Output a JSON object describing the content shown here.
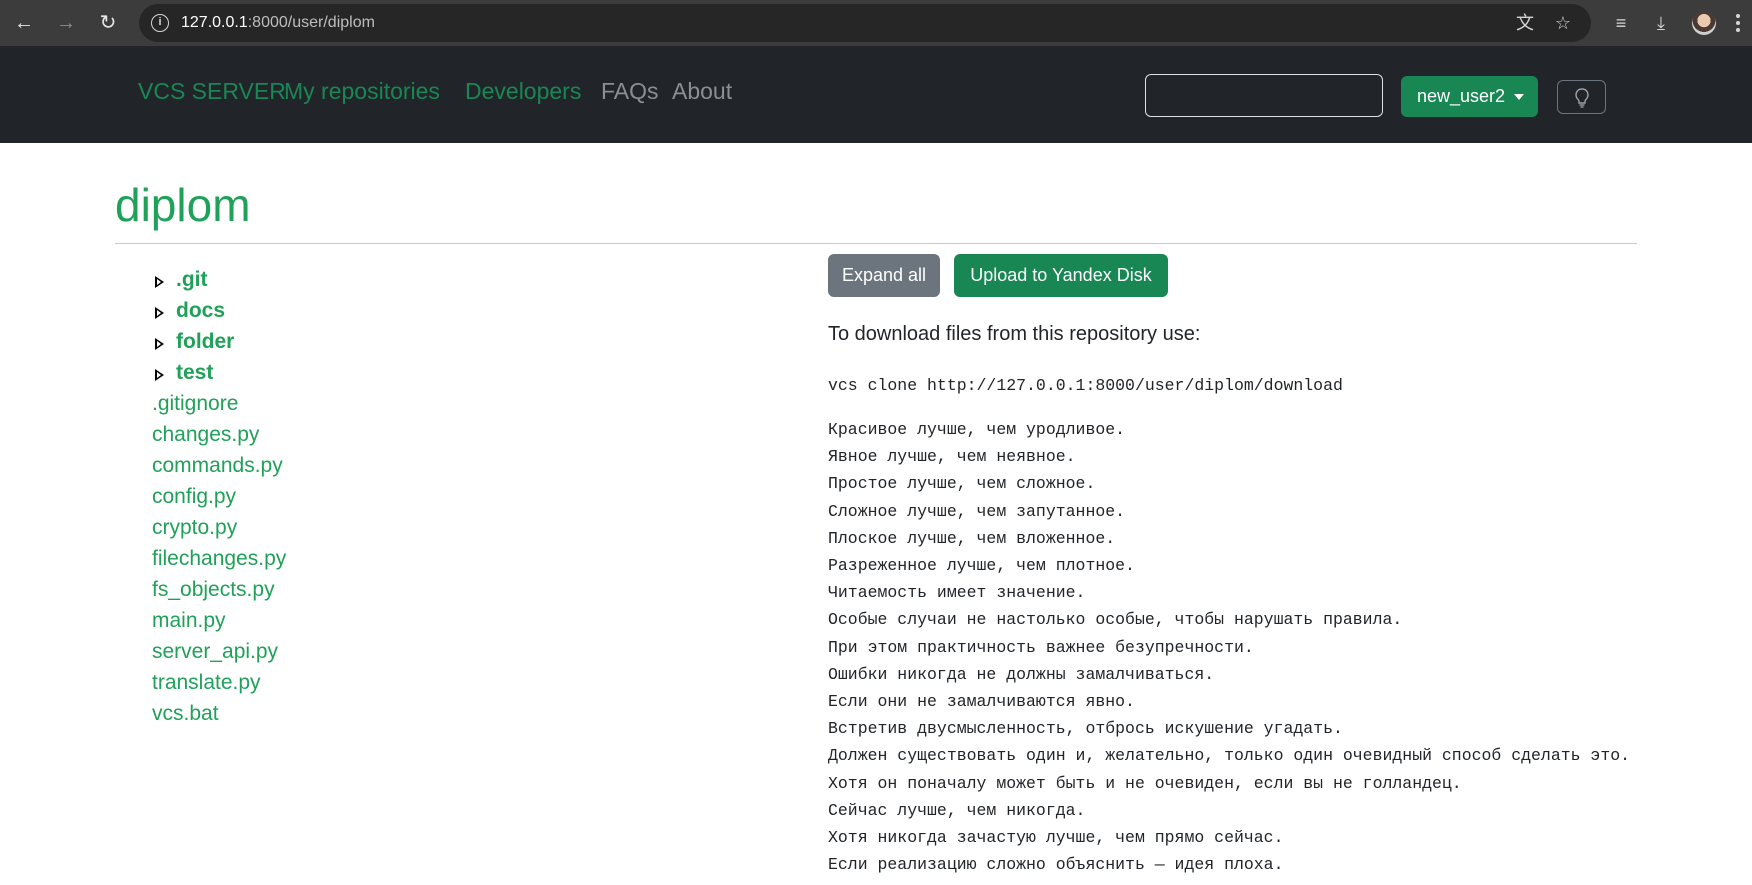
{
  "browser": {
    "url_host": "127.0.0.1",
    "url_path": ":8000/user/diplom",
    "icons": [
      "back-icon",
      "forward-icon",
      "reload-icon",
      "site-info-icon",
      "translate-icon",
      "star-icon",
      "reading-list-icon",
      "downloads-icon",
      "profile-avatar",
      "menu-icon"
    ]
  },
  "navbar": {
    "brand": "VCS SERVER",
    "links": [
      {
        "label": "My repositories"
      },
      {
        "label": "Developers"
      },
      {
        "label": "FAQs"
      },
      {
        "label": "About"
      }
    ],
    "search_value": "",
    "user_label": "new_user2",
    "theme_icon": "lightbulb-icon"
  },
  "repo": {
    "title": "diplom",
    "folders": [
      ".git",
      "docs",
      "folder",
      "test"
    ],
    "files": [
      ".gitignore",
      "changes.py",
      "commands.py",
      "config.py",
      "crypto.py",
      "filechanges.py",
      "fs_objects.py",
      "main.py",
      "server_api.py",
      "translate.py",
      "vcs.bat"
    ],
    "expand_label": "Expand all",
    "upload_label": "Upload to Yandex Disk",
    "download_hint": "To download files from this repository use:",
    "clone_command": "vcs clone http://127.0.0.1:8000/user/diplom/download",
    "readme_lines": [
      "Красивое лучше, чем уродливое.",
      "Явное лучше, чем неявное.",
      "Простое лучше, чем сложное.",
      "Сложное лучше, чем запутанное.",
      "Плоское лучше, чем вложенное.",
      "Разреженное лучше, чем плотное.",
      "Читаемость имеет значение.",
      "Особые случаи не настолько особые, чтобы нарушать правила.",
      "При этом практичность важнее безупречности.",
      "Ошибки никогда не должны замалчиваться.",
      "Если они не замалчиваются явно.",
      "Встретив двусмысленность, отбрось искушение угадать.",
      "Должен существовать один и, желательно, только один очевидный способ сделать это.",
      "Хотя он поначалу может быть и не очевиден, если вы не голландец.",
      "Сейчас лучше, чем никогда.",
      "Хотя никогда зачастую лучше, чем прямо сейчас.",
      "Если реализацию сложно объяснить — идея плоха."
    ]
  },
  "colors": {
    "accent_green": "#198754",
    "link_green": "#20a159",
    "navbar_bg": "#212529",
    "secondary_btn": "#6c757d"
  }
}
